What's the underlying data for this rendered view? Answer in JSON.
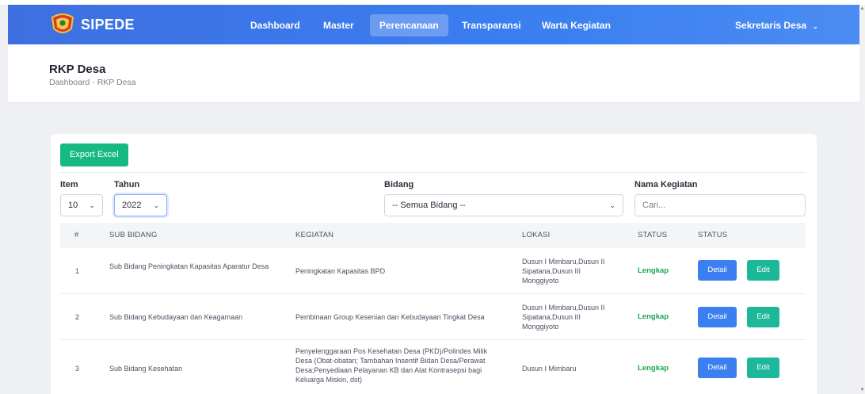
{
  "app": {
    "brand": "SIPEDE",
    "nav": [
      {
        "label": "Dashboard",
        "active": false
      },
      {
        "label": "Master",
        "active": false
      },
      {
        "label": "Perencanaan",
        "active": true
      },
      {
        "label": "Transparansi",
        "active": false
      },
      {
        "label": "Warta Kegiatan",
        "active": false
      }
    ],
    "user": "Sekretaris Desa",
    "accent": "#3a7ef0"
  },
  "header": {
    "title": "RKP Desa",
    "breadcrumb": "Dashboard - RKP Desa"
  },
  "toolbar": {
    "export_label": "Export Excel"
  },
  "filters": {
    "item_label": "Item",
    "item_value": "10",
    "tahun_label": "Tahun",
    "tahun_value": "2022",
    "bidang_label": "Bidang",
    "bidang_value": "-- Semua Bidang --",
    "nama_label": "Nama Kegiatan",
    "nama_placeholder": "Cari..."
  },
  "table": {
    "columns": [
      "#",
      "SUB BIDANG",
      "KEGIATAN",
      "LOKASI",
      "STATUS",
      "STATUS"
    ],
    "rows": [
      {
        "no": "1",
        "sub_bidang": "Sub Bidang Peningkatan Kapasitas Aparatur Desa",
        "kegiatan": "Peningkatan Kapasitas BPD",
        "lokasi": "Dusun I Mimbaru,Dusun II Sipatana,Dusun III Monggiyoto",
        "status": "Lengkap",
        "detail": "Detail",
        "edit": "Edit"
      },
      {
        "no": "2",
        "sub_bidang": "Sub Bidang Kebudayaan dan Keagamaan",
        "kegiatan": "Pembinaan Group Kesenian dan Kebudayaan Tingkat Desa",
        "lokasi": "Dusun I Mimbaru,Dusun II Sipatana,Dusun III Monggiyoto",
        "status": "Lengkap",
        "detail": "Detail",
        "edit": "Edit"
      },
      {
        "no": "3",
        "sub_bidang": "Sub Bidang Kesehatan",
        "kegiatan": "Penyelenggaraan Pos Kesehatan Desa (PKD)/Polindes Milik Desa (Obat-obatan; Tambahan Insentif Bidan Desa/Perawat Desa;Penyediaan Pelayanan KB dan Alat Kontrasepsi bagi Keluarga Miskin, dst)",
        "lokasi": "Dusun I Mimbaru",
        "status": "Lengkap",
        "detail": "Detail",
        "edit": "Edit"
      }
    ]
  },
  "colors": {
    "export": "#16b981",
    "detail": "#3b7ff0",
    "edit": "#1db79a",
    "status_ok": "#17a94e"
  }
}
